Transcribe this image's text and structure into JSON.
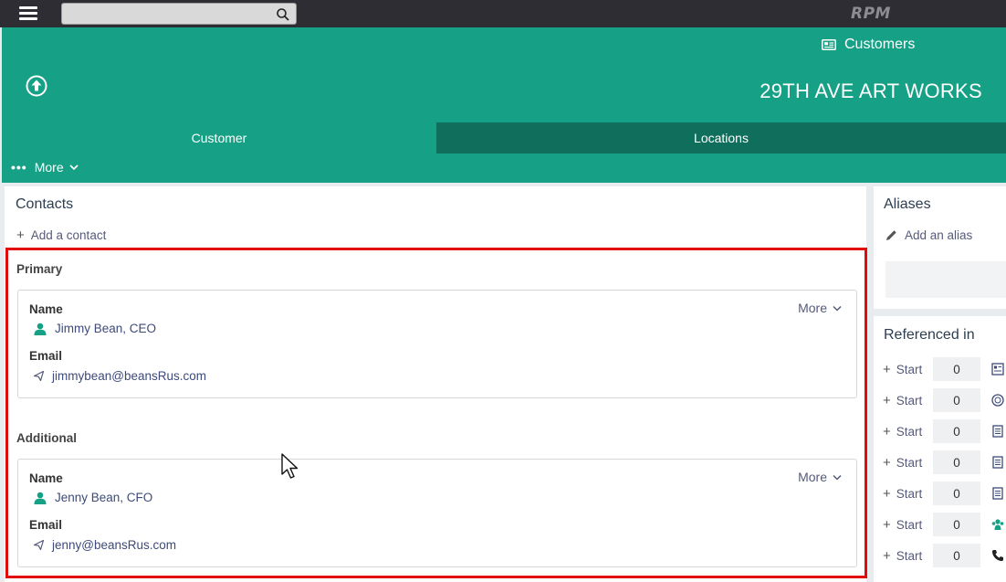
{
  "topbar": {
    "search_value": "",
    "logo_text": "RPM"
  },
  "header": {
    "customers_link": "Customers",
    "customer_name": "29TH AVE ART WORKS"
  },
  "tabs": [
    {
      "label": "Customer",
      "active": true
    },
    {
      "label": "Locations",
      "active": false
    }
  ],
  "more_menu": {
    "label": "More"
  },
  "contacts": {
    "title": "Contacts",
    "add_label": "Add a contact",
    "primary": {
      "section_label": "Primary",
      "name_label": "Name",
      "name_value": "Jimmy Bean, CEO",
      "email_label": "Email",
      "email_value": "jimmybean@beansRus.com",
      "more_label": "More"
    },
    "additional": {
      "section_label": "Additional",
      "name_label": "Name",
      "name_value": "Jenny Bean, CFO",
      "email_label": "Email",
      "email_value": "jenny@beansRus.com",
      "more_label": "More"
    }
  },
  "aliases": {
    "title": "Aliases",
    "add_label": "Add an alias"
  },
  "referenced_in": {
    "title": "Referenced in",
    "rows": [
      {
        "start_label": "Start",
        "count": "0",
        "icon": "form-icon"
      },
      {
        "start_label": "Start",
        "count": "0",
        "icon": "coin-icon"
      },
      {
        "start_label": "Start",
        "count": "0",
        "icon": "document-icon"
      },
      {
        "start_label": "Start",
        "count": "0",
        "icon": "document-icon"
      },
      {
        "start_label": "Start",
        "count": "0",
        "icon": "document-icon"
      },
      {
        "start_label": "Start",
        "count": "0",
        "icon": "people-icon"
      },
      {
        "start_label": "Start",
        "count": "0",
        "icon": "phone-icon"
      }
    ]
  },
  "colors": {
    "brand_green": "#16a085",
    "dark_green": "#0f6e5c",
    "highlight_red": "#e00b0b",
    "topbar": "#2d2d33"
  }
}
